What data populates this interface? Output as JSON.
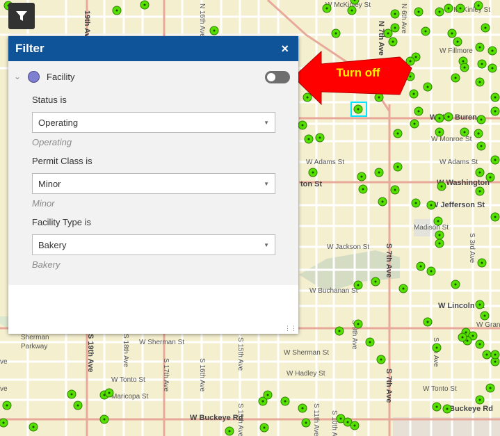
{
  "streets": {
    "w_mckinley_top": "W McKinley St",
    "w_mckinley_right": "W McKinley St",
    "w_fillmore": "W Fillmore",
    "w_van_buren": "W Van Buren",
    "w_monroe": "W Monroe St",
    "w_adams_mid": "W Adams St",
    "w_adams_right": "W Adams St",
    "w_washington_mid": "ton St",
    "w_washington_right": "W Washington",
    "w_jefferson": "W Jefferson St",
    "w_madison": "Madison St",
    "w_jackson": "W Jackson St",
    "w_buchanan": "W Buchanan St",
    "w_lincoln": "W Lincoln St",
    "w_grant": "W Grant",
    "w_sherman_left": "W Sherman St",
    "w_sherman_mid": "W Sherman St",
    "w_hadley": "W Hadley St",
    "w_tonto_left": "W Tonto St",
    "w_tonto_right": "W Tonto St",
    "maricopa": "Maricopa St",
    "w_buckeye_left": "W Buckeye Rd",
    "w_buckeye_right": "Buckeye Rd",
    "n_7th_ave": "N 7th Ave",
    "s_7th_ave_mid": "S 7th Ave",
    "s_7th_ave_bottom": "S 7th Ave",
    "s_19th_ave": "S 19th Ave",
    "n_19th_ave": "19th Ave",
    "s_18th_ave": "S 18th Ave",
    "s_17th_ave": "S 17th Ave",
    "s_16th_ave": "S 16th Ave",
    "s_15th_ave": "S 15th Ave",
    "s_11th_ave": "S 11th Ave",
    "s_9th_ave": "S 9th Ave",
    "s_3rd_ave": "S 3rd Ave",
    "s_5th_ave": "S 5th Ave",
    "s_10th_ave": "S 10th Ave",
    "s_15th_ave_b": "S 15th Ave",
    "n_16th_ave": "N 16th Ave",
    "n_6th_ave": "N 6th Ave",
    "parkway_1": "Sherman",
    "parkway_2": "Parkway",
    "ve_left": "ve",
    "ave_left": "Ave",
    "grand_ave": "Ave"
  },
  "filter": {
    "title": "Filter",
    "close_label": "×",
    "layer_name": "Facility",
    "layer_color": "#7f7fd1",
    "toggle_state": "off",
    "expressions": [
      {
        "label": "Status is",
        "value": "Operating",
        "hint": "Operating"
      },
      {
        "label": "Permit Class is",
        "value": "Minor",
        "hint": "Minor"
      },
      {
        "label": "Facility Type is",
        "value": "Bakery",
        "hint": "Bakery"
      }
    ]
  },
  "annotation": {
    "text": "Turn off",
    "color": "#ff0000"
  },
  "colors": {
    "map_bg": "#f4efcf",
    "major_road": "#e8a89a",
    "minor_road": "#ffffff",
    "point": "#55e000",
    "header": "#0f5499"
  }
}
